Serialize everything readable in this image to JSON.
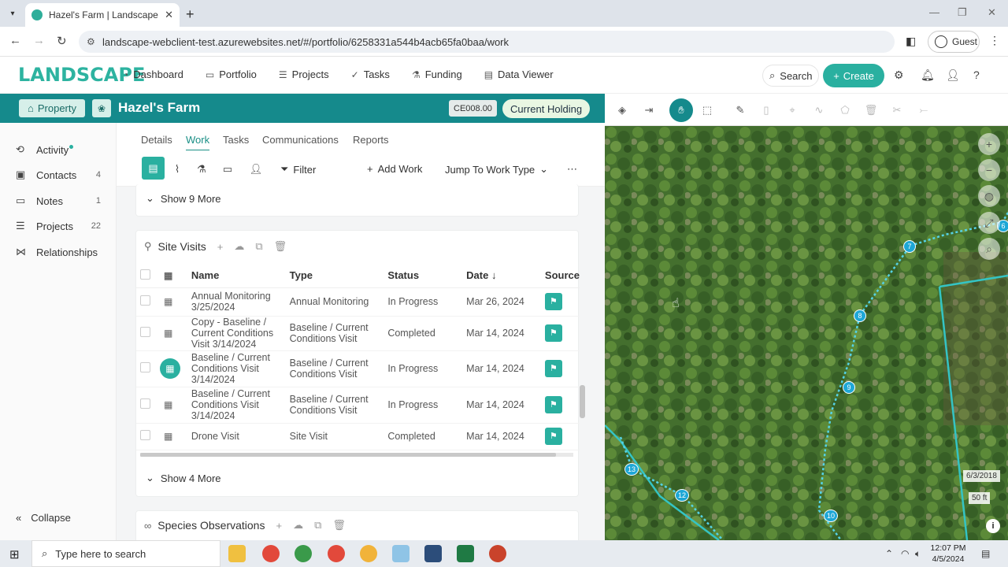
{
  "browser": {
    "tab_title": "Hazel's Farm | Landscape",
    "url": "landscape-webclient-test.azurewebsites.net/#/portfolio/6258331a544b4acb65fa0baa/work",
    "profile_label": "Guest"
  },
  "header": {
    "logo": "LANDSCAPE",
    "nav": [
      {
        "label": "Dashboard",
        "icon": "dashboard-icon"
      },
      {
        "label": "Portfolio",
        "icon": "folder-icon"
      },
      {
        "label": "Projects",
        "icon": "projects-icon"
      },
      {
        "label": "Tasks",
        "icon": "check-icon"
      },
      {
        "label": "Funding",
        "icon": "funding-icon"
      },
      {
        "label": "Data Viewer",
        "icon": "document-icon"
      }
    ],
    "search_label": "Search",
    "create_label": "Create"
  },
  "property": {
    "type_label": "Property",
    "name": "Hazel's Farm",
    "code": "CE008.00",
    "status": "Current Holding"
  },
  "sidebar": {
    "items": [
      {
        "label": "Activity",
        "count": ""
      },
      {
        "label": "Contacts",
        "count": "4"
      },
      {
        "label": "Notes",
        "count": "1"
      },
      {
        "label": "Projects",
        "count": "22"
      },
      {
        "label": "Relationships",
        "count": ""
      }
    ],
    "collapse_label": "Collapse"
  },
  "subtabs": [
    "Details",
    "Work",
    "Tasks",
    "Communications",
    "Reports"
  ],
  "toolbar": {
    "filter_label": "Filter",
    "add_work_label": "Add Work",
    "jump_label": "Jump To Work Type"
  },
  "top_card": {
    "show_more": "Show 9 More"
  },
  "site_visits": {
    "title": "Site Visits",
    "columns": [
      "Name",
      "Type",
      "Status",
      "Date",
      "Source"
    ],
    "rows": [
      {
        "name": "Annual Monitoring 3/25/2024",
        "type": "Annual Monitoring",
        "status": "In Progress",
        "date": "Mar 26, 2024"
      },
      {
        "name": "Copy - Baseline / Current Conditions Visit 3/14/2024",
        "type": "Baseline / Current Conditions Visit",
        "status": "Completed",
        "date": "Mar 14, 2024"
      },
      {
        "name": "Baseline / Current Conditions Visit 3/14/2024",
        "type": "Baseline / Current Conditions Visit",
        "status": "In Progress",
        "date": "Mar 14, 2024"
      },
      {
        "name": "Baseline / Current Conditions Visit 3/14/2024",
        "type": "Baseline / Current Conditions Visit",
        "status": "In Progress",
        "date": "Mar 14, 2024"
      },
      {
        "name": "Drone Visit",
        "type": "Site Visit",
        "status": "Completed",
        "date": "Mar 14, 2024"
      }
    ],
    "show_more": "Show 4 More"
  },
  "species": {
    "title": "Species Observations"
  },
  "map": {
    "date_label": "6/3/2018",
    "scale_label": "50 ft",
    "points": [
      "6",
      "7",
      "8",
      "9",
      "10",
      "12",
      "13"
    ]
  },
  "taskbar": {
    "search_placeholder": "Type here to search",
    "time": "12:07 PM",
    "date": "4/5/2024"
  },
  "colors": {
    "accent": "#2ab0a0",
    "property_bar": "#158a8c",
    "boundary": "#34c4c4"
  }
}
